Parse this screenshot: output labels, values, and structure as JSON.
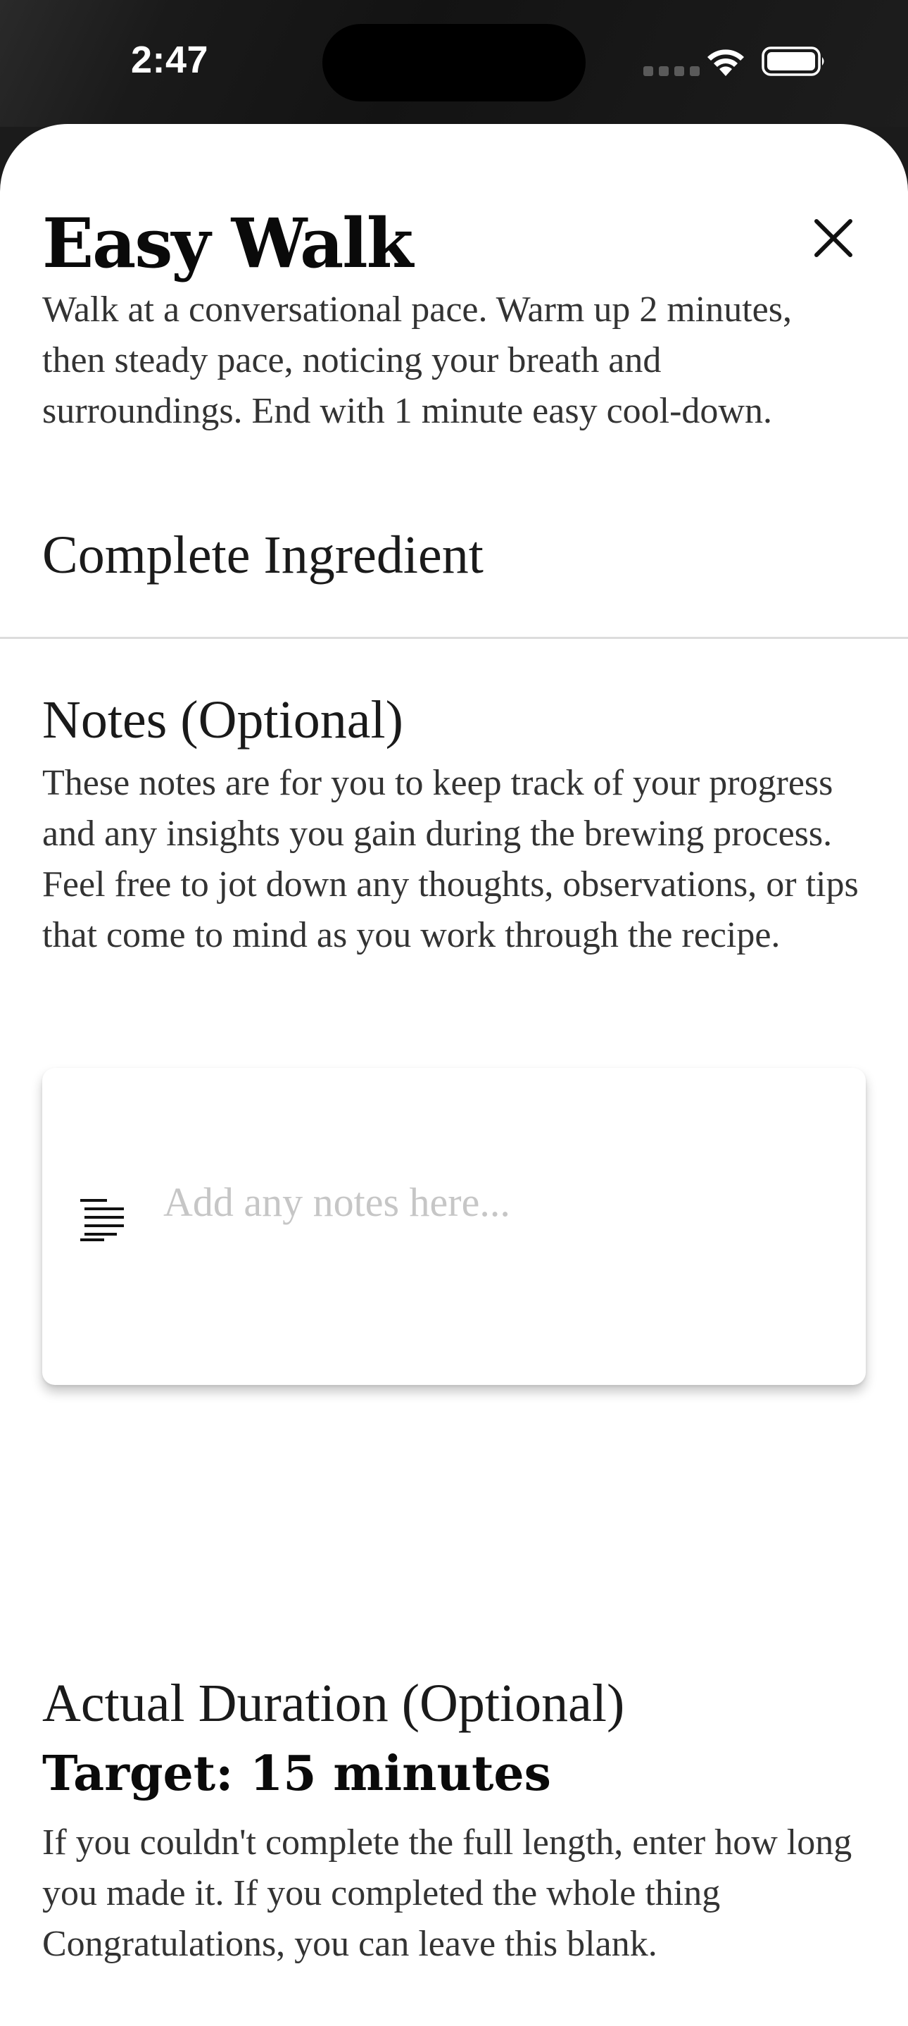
{
  "status_bar": {
    "time": "2:47"
  },
  "sheet": {
    "title": "Easy Walk",
    "close_icon": "close-icon",
    "description": "Walk at a conversational pace. Warm up 2 minutes, then steady pace, noticing your breath and surroundings. End with 1 minute easy cool-down.",
    "complete_label": "Complete Ingredient"
  },
  "notes": {
    "heading": "Notes (Optional)",
    "description": "These notes are for you to keep track of your progress and any insights you gain during the brewing process. Feel free to jot down any thoughts, observations, or tips that come to mind as you work through the recipe.",
    "placeholder": "Add any notes here...",
    "value": "",
    "icon": "text-lines-icon"
  },
  "duration": {
    "heading": "Actual Duration (Optional)",
    "target": "Target: 15 minutes",
    "description": "If you couldn't complete the full length, enter how long you made it. If you completed the whole thing Congratulations, you can leave this blank."
  }
}
